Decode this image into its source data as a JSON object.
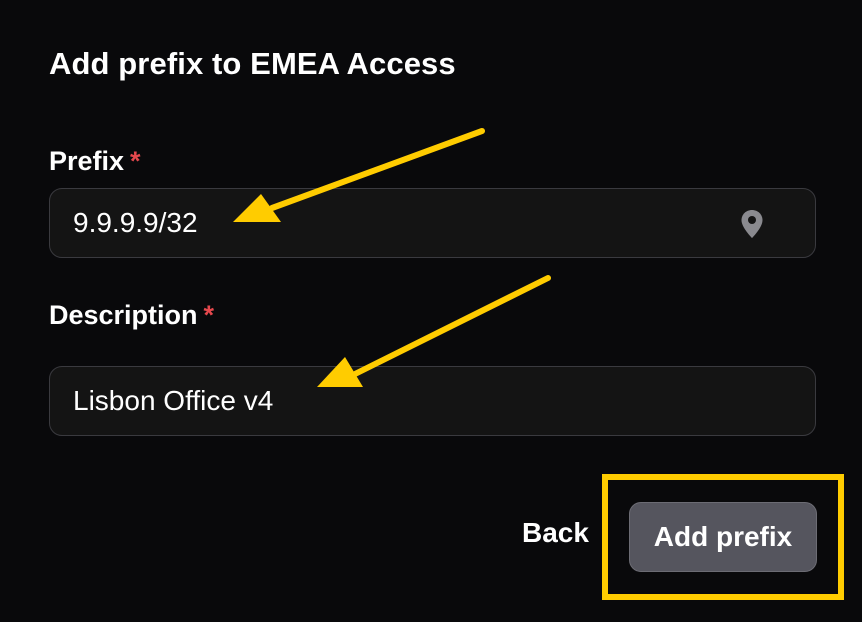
{
  "dialog": {
    "title": "Add prefix to EMEA Access"
  },
  "fields": {
    "prefix": {
      "label": "Prefix",
      "required_marker": "*",
      "value": "9.9.9.9/32",
      "icon": "map-pin-icon"
    },
    "description": {
      "label": "Description",
      "required_marker": "*",
      "value": "Lisbon Office v4"
    }
  },
  "actions": {
    "back_label": "Back",
    "submit_label": "Add prefix"
  },
  "colors": {
    "background": "#09090b",
    "input_background": "#141414",
    "input_border": "#3a3a3f",
    "required": "#e5484d",
    "submit_button": "#55555e",
    "annotation": "#ffcc00",
    "icon": "#8a8a8f"
  }
}
